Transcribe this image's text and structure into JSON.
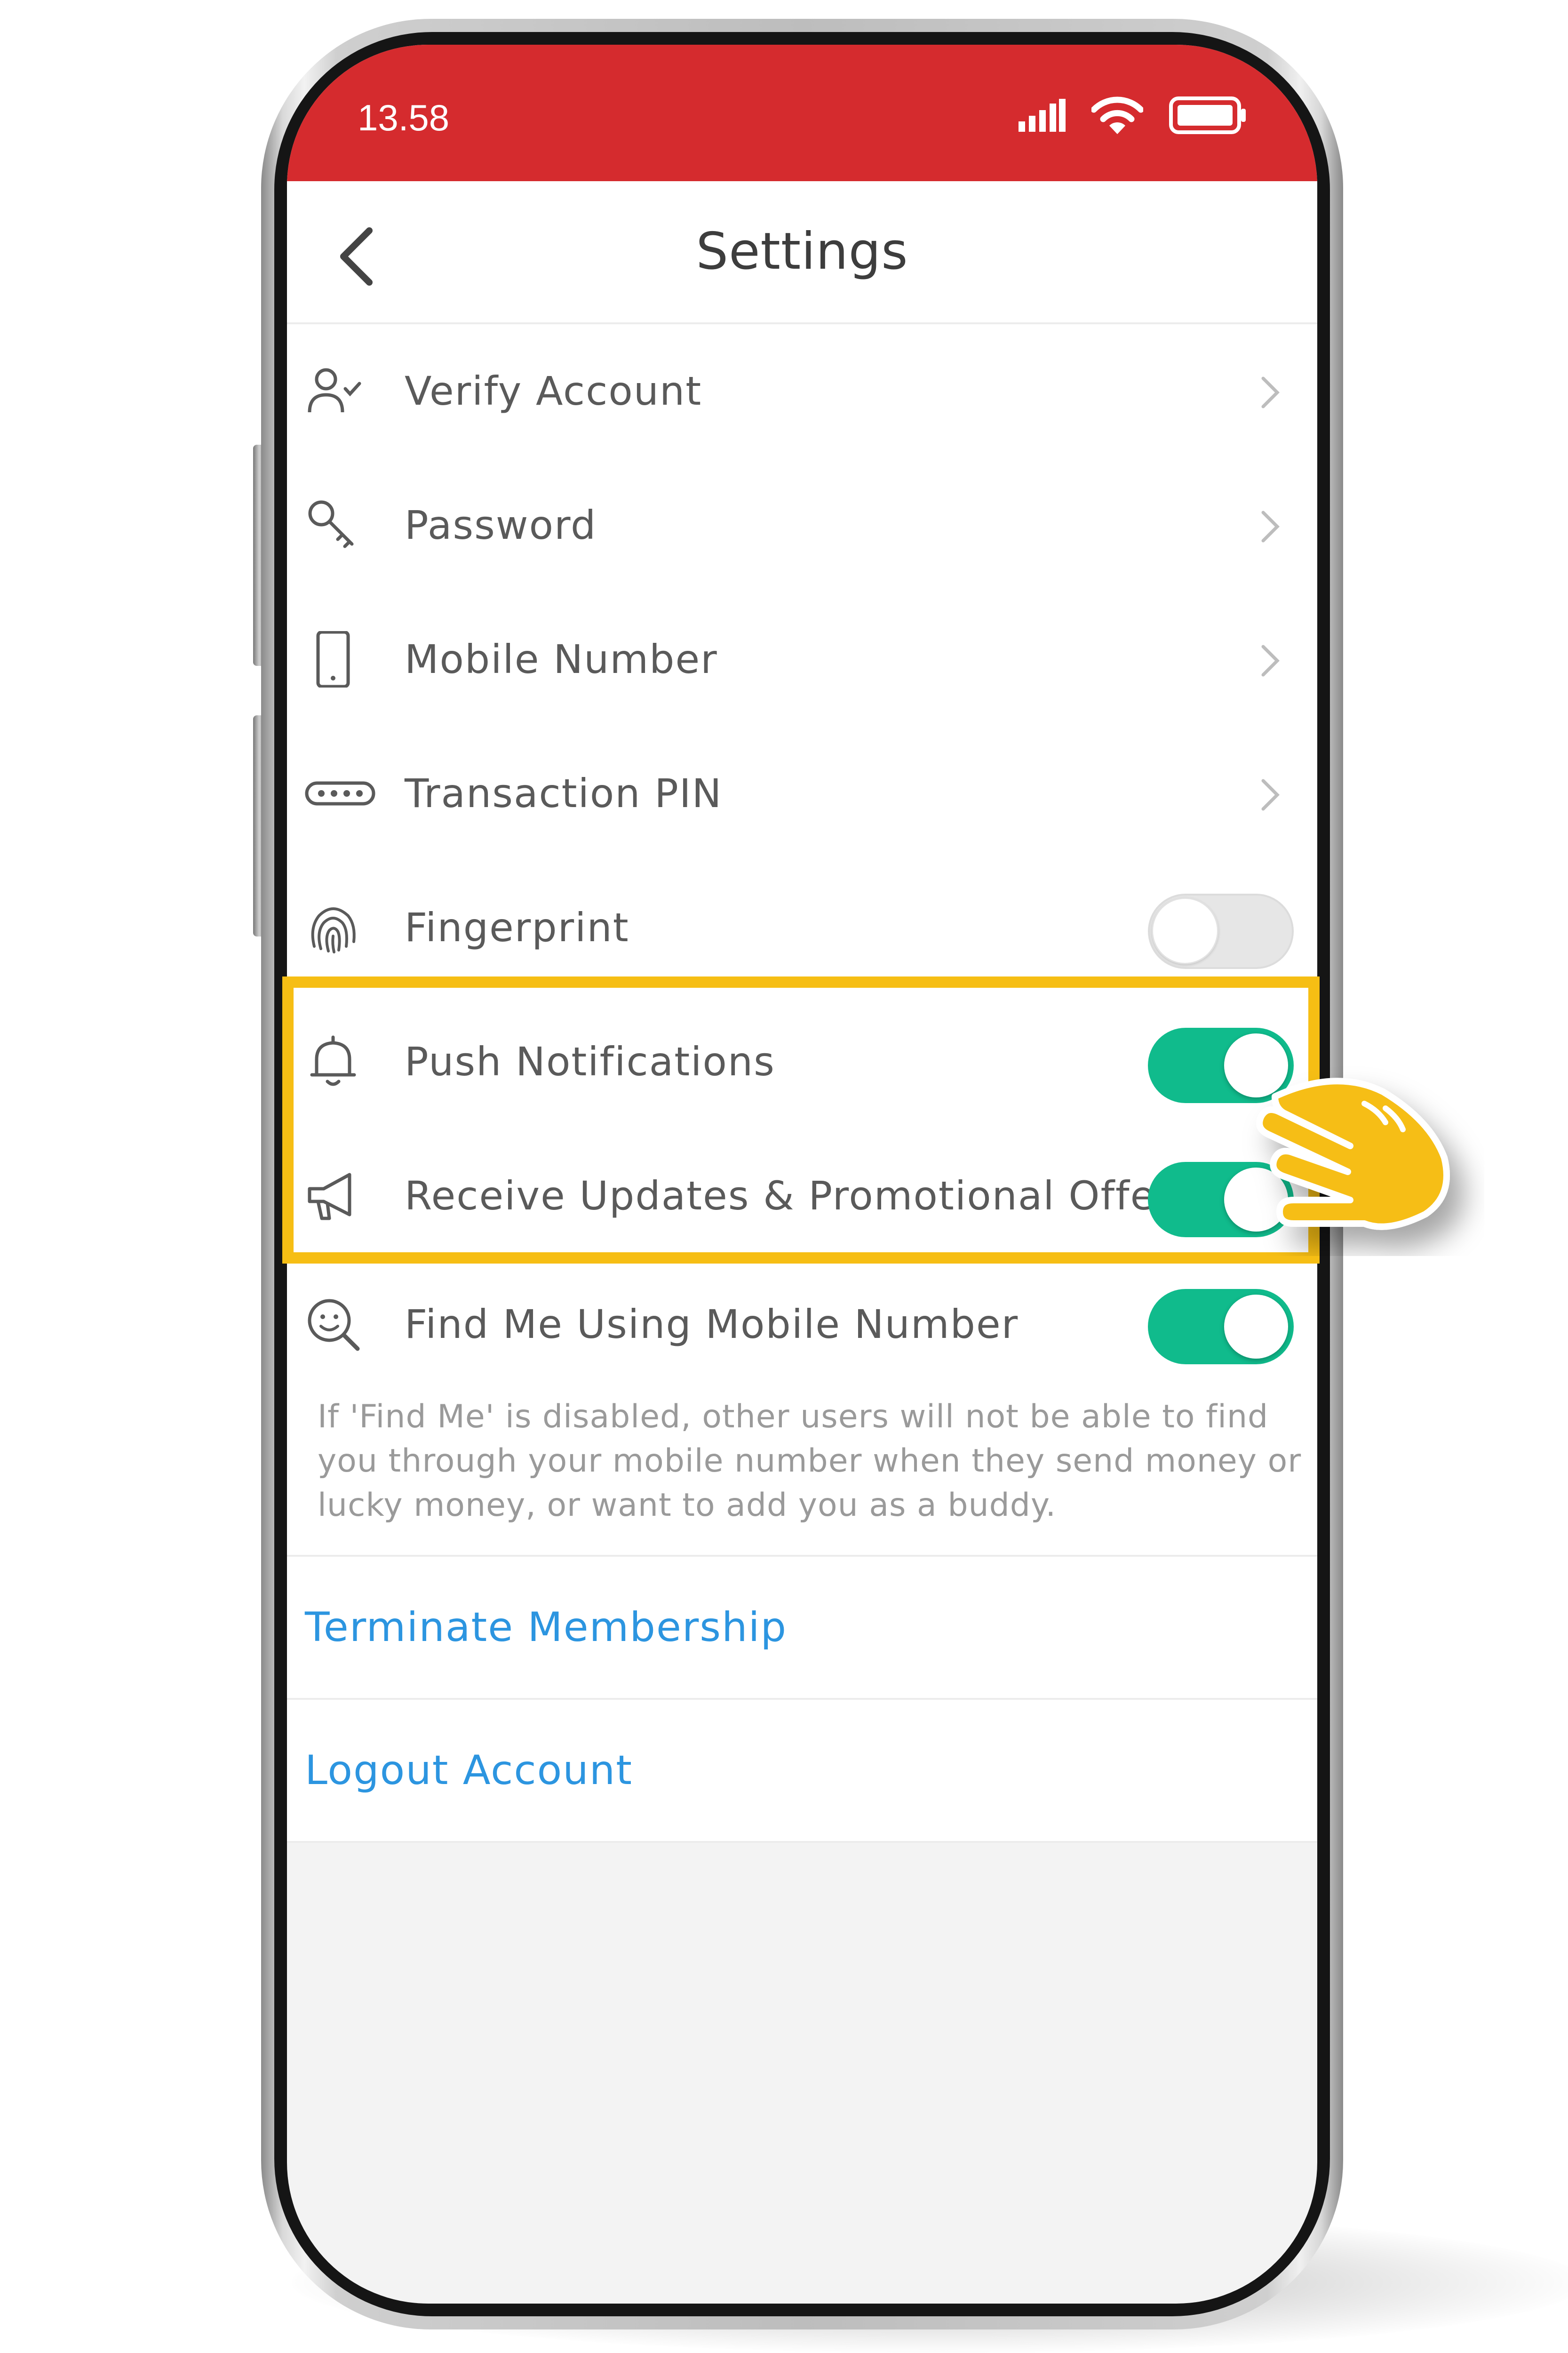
{
  "status_bar": {
    "time": "13.58",
    "color": "#d52b2e"
  },
  "header": {
    "title": "Settings",
    "back_icon": "chevron-left-icon"
  },
  "rows": [
    {
      "label": "Verify Account",
      "icon": "user-check-icon",
      "control": "chevron"
    },
    {
      "label": "Password",
      "icon": "key-icon",
      "control": "chevron"
    },
    {
      "label": "Mobile Number",
      "icon": "mobile-phone-icon",
      "control": "chevron"
    },
    {
      "label": "Transaction PIN",
      "icon": "pin-dots-icon",
      "control": "chevron"
    },
    {
      "label": "Fingerprint",
      "icon": "fingerprint-icon",
      "control": "toggle",
      "state": "off"
    },
    {
      "label": "Push Notifications",
      "icon": "bell-icon",
      "control": "toggle",
      "state": "on"
    },
    {
      "label": "Receive Updates & Promotional Offers",
      "icon": "megaphone-icon",
      "control": "toggle",
      "state": "on"
    },
    {
      "label": "Find Me Using Mobile Number",
      "icon": "face-search-icon",
      "control": "toggle",
      "state": "on"
    }
  ],
  "find_me_note": "If 'Find Me' is disabled, other users will not be able to find you through your mobile number when they send money or lucky money, or want to add you as a buddy.",
  "links": {
    "terminate": "Terminate Membership",
    "logout": "Logout Account"
  },
  "colors": {
    "toggle_on": "#10bb8c",
    "link": "#2c95e0",
    "highlight": "#f6be14"
  }
}
